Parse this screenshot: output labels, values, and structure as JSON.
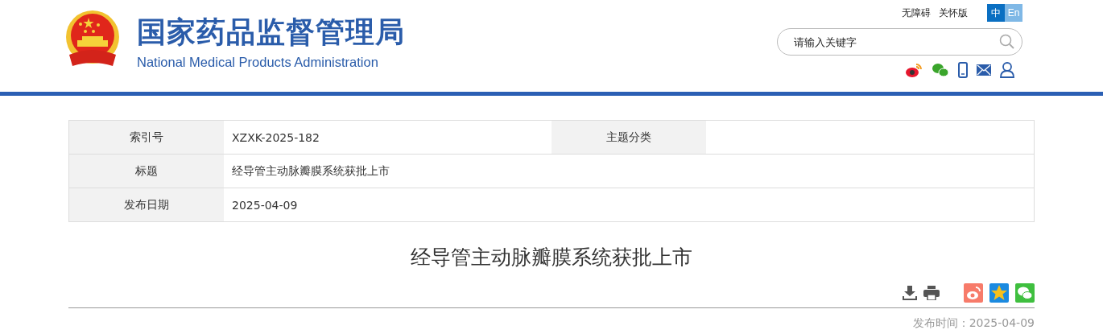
{
  "header": {
    "title": "国家药品监督管理局",
    "subtitle": "National Medical Products Administration",
    "links": [
      "无障碍",
      "关怀版"
    ],
    "languages": [
      {
        "label": "中",
        "selected": true
      },
      {
        "label": "En",
        "selected": false
      }
    ],
    "search": {
      "placeholder": "请输入关键字"
    }
  },
  "info_table": {
    "rows": [
      {
        "cells": [
          {
            "label": "索引号",
            "value": "XZXK-2025-182"
          },
          {
            "label": "主题分类"
          }
        ]
      },
      {
        "cells": [
          {
            "label": "标题",
            "value": "经导管主动脉瓣膜系统获批上市"
          }
        ]
      },
      {
        "cells": [
          {
            "label": "发布日期",
            "value": "2025-04-09"
          }
        ]
      }
    ]
  },
  "article": {
    "title": "经导管主动脉瓣膜系统获批上市",
    "published": "发布时间：2025-04-09"
  }
}
